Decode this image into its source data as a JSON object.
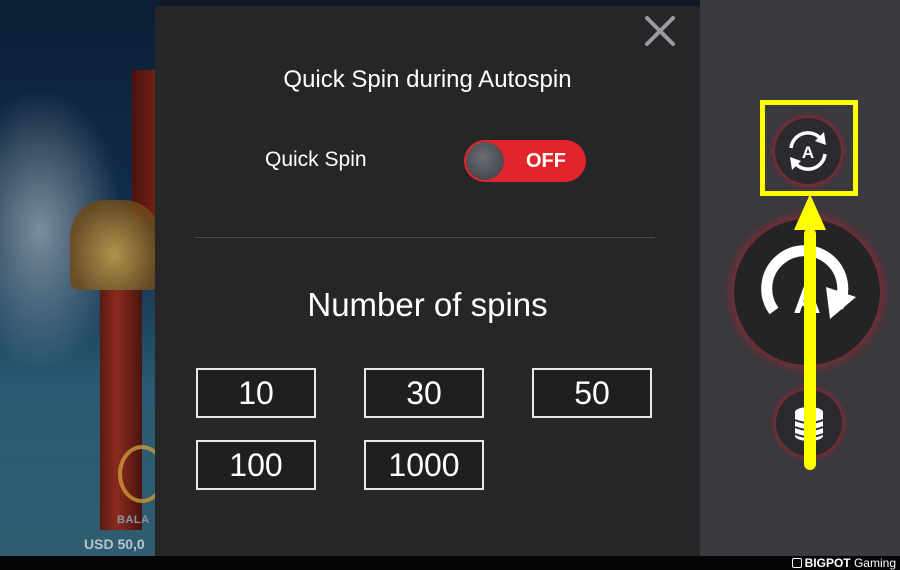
{
  "modal": {
    "title": "Quick Spin during Autospin",
    "quick_spin_label": "Quick Spin",
    "toggle_state": "OFF",
    "spins_title": "Number of spins",
    "spin_options": [
      "10",
      "30",
      "50",
      "100",
      "1000"
    ]
  },
  "balance": {
    "label": "BALA",
    "value": "USD 50,0"
  },
  "footer": {
    "brand_bold": "BIGPOT",
    "brand_rest": " Gaming"
  },
  "sidebar": {
    "auto_icon": "autospin-icon",
    "spin_icon": "spin-icon",
    "coins_icon": "coin-stack-icon"
  },
  "colors": {
    "modal_bg": "#262629",
    "toggle_off": "#e2252b",
    "sidebar_bg": "#3a3a3f",
    "highlight": "#ffff00",
    "glow": "#be1e28"
  }
}
